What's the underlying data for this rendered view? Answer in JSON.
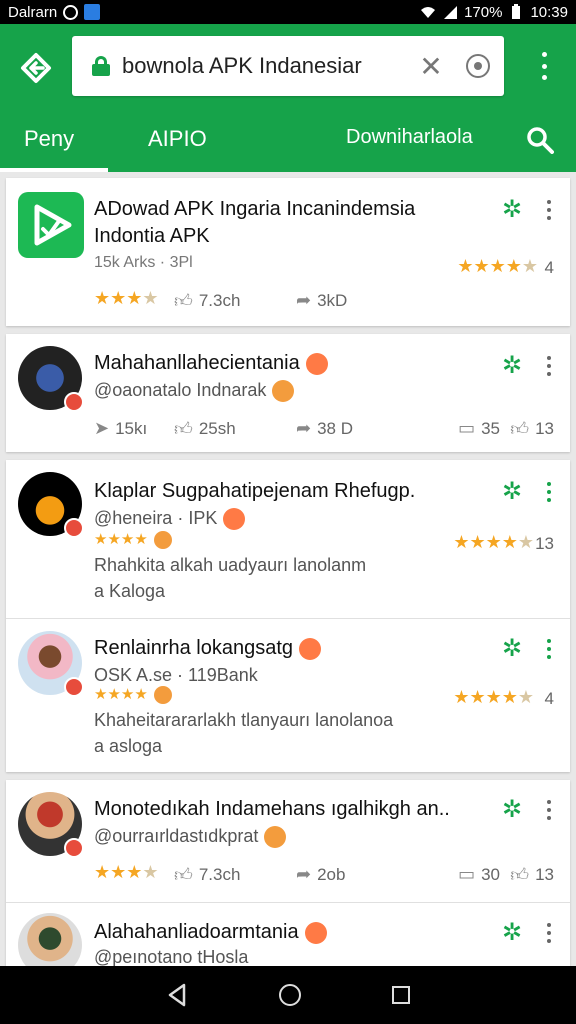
{
  "status": {
    "carrier": "Dalrarn",
    "battery": "170%",
    "time": "10:39"
  },
  "browser": {
    "url_text": "bownola APK Indanesiar",
    "clear_symbol": "✕"
  },
  "tabs": [
    {
      "label": "Peny"
    },
    {
      "label": "AIPIO"
    },
    {
      "label": "Downiharlaola"
    }
  ],
  "featured": {
    "title_line1": "ADowad APK Ingaria Incanindemsia",
    "title_line2": "Indontia APK",
    "meta": "15k Arks · 3Pl",
    "rating_count": "4",
    "likes": "7.3ch",
    "comments": "3kD"
  },
  "posts": [
    {
      "title": "Mahahanllahecientania",
      "handle": "@oaonatalo Indnarak",
      "shares": "15kı",
      "likes": "25sh",
      "comments": "38 D",
      "saves": "35",
      "upvotes": "13"
    },
    {
      "title": "Klaplar Sugpahatipejenam Rhefugp.",
      "handle": "@heneira · IPK",
      "body_line1": "Rhahkita alkah uadyaurı lanolanm",
      "body_line2": "a Kaloga",
      "rating_count": "13"
    },
    {
      "title": "Renlainrha lokangsatg",
      "handle": "OSK A.se · 119Bank",
      "body_line1": "Khaheitarararlakh tlanyaurı lanolanoa",
      "body_line2": "a asloga",
      "rating_count": "4"
    },
    {
      "title": "Monotedıkah Indamehans ıgalhikgh an..",
      "handle": "@ourraırldastıdkprat",
      "likes": "7.3ch",
      "comments": "2ob",
      "saves": "30",
      "upvotes": "13"
    },
    {
      "title": "Alahahanliadoarmtania",
      "handle": "@peınotano tHosla"
    }
  ],
  "colors": {
    "brand_green": "#16a34a",
    "star_gold": "#f5a623"
  }
}
